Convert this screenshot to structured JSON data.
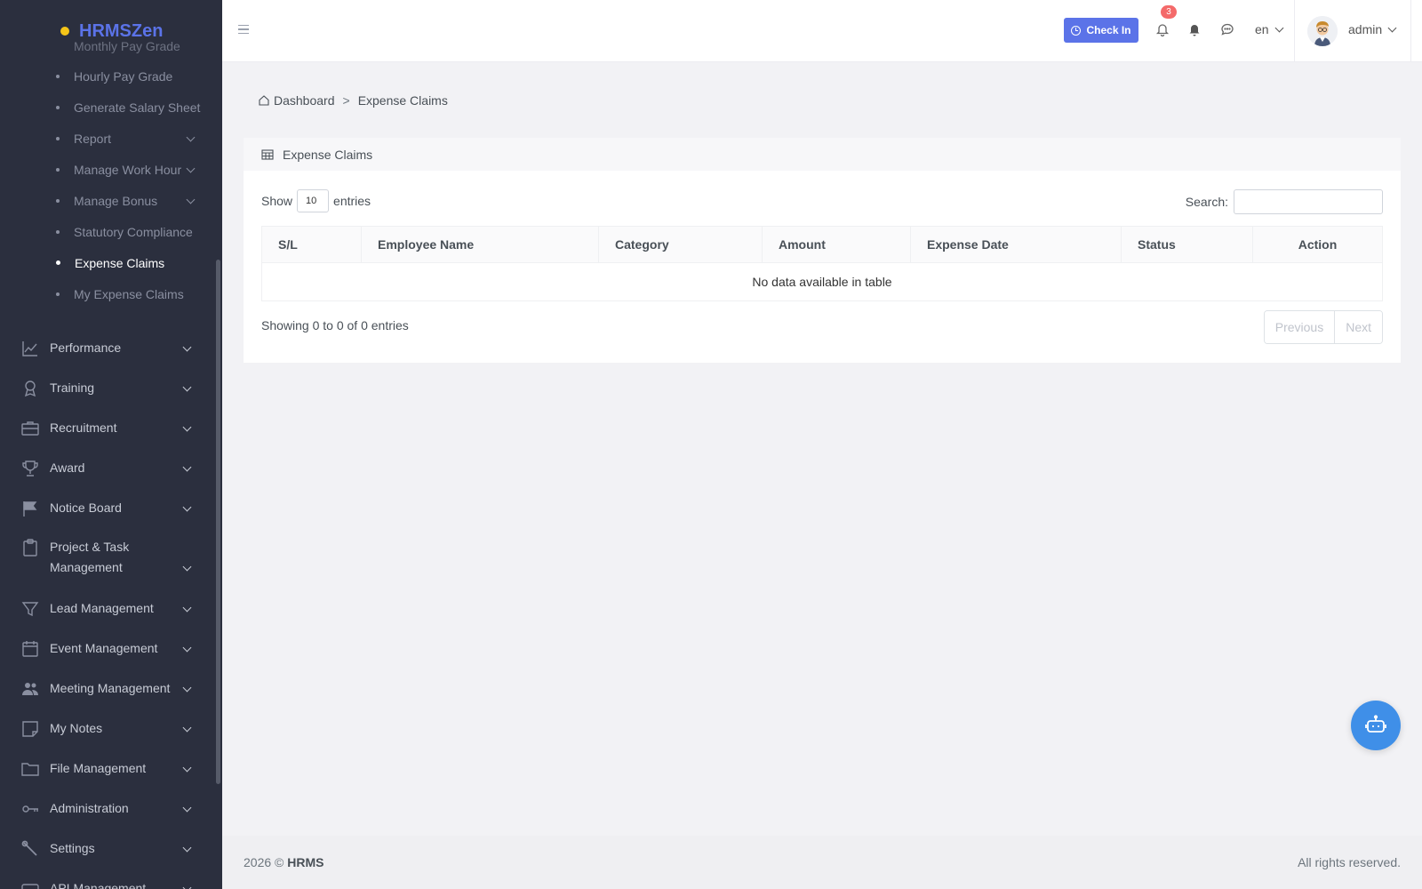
{
  "brand": {
    "name": "HRMSZen"
  },
  "sidebar": {
    "subitems": [
      {
        "label": "Monthly Pay Grade",
        "has_children": false,
        "active": false
      },
      {
        "label": "Hourly Pay Grade",
        "has_children": false,
        "active": false
      },
      {
        "label": "Generate Salary Sheet",
        "has_children": false,
        "active": false
      },
      {
        "label": "Report",
        "has_children": true,
        "active": false
      },
      {
        "label": "Manage Work Hour",
        "has_children": true,
        "active": false
      },
      {
        "label": "Manage Bonus",
        "has_children": true,
        "active": false
      },
      {
        "label": "Statutory Compliance",
        "has_children": false,
        "active": false
      },
      {
        "label": "Expense Claims",
        "has_children": false,
        "active": true
      },
      {
        "label": "My Expense Claims",
        "has_children": false,
        "active": false
      }
    ],
    "items": [
      {
        "label": "Performance",
        "icon": "chart-line-icon"
      },
      {
        "label": "Training",
        "icon": "award-ribbon-icon"
      },
      {
        "label": "Recruitment",
        "icon": "briefcase-icon"
      },
      {
        "label": "Award",
        "icon": "trophy-icon"
      },
      {
        "label": "Notice Board",
        "icon": "flag-icon"
      },
      {
        "label": "Project & Task Management",
        "icon": "clipboard-icon"
      },
      {
        "label": "Lead Management",
        "icon": "funnel-icon"
      },
      {
        "label": "Event Management",
        "icon": "calendar-icon"
      },
      {
        "label": "Meeting Management",
        "icon": "users-icon"
      },
      {
        "label": "My Notes",
        "icon": "note-icon"
      },
      {
        "label": "File Management",
        "icon": "folder-icon"
      },
      {
        "label": "Administration",
        "icon": "key-icon"
      },
      {
        "label": "Settings",
        "icon": "wrench-icon"
      },
      {
        "label": "API Management",
        "icon": "api-icon"
      }
    ]
  },
  "topbar": {
    "checkin_label": "Check In",
    "notification_count": "3",
    "language": "en",
    "username": "admin"
  },
  "breadcrumb": {
    "home": "Dashboard",
    "separator": ">",
    "current": "Expense Claims"
  },
  "card": {
    "title": "Expense Claims",
    "show_label": "Show",
    "entries_value": "10",
    "entries_label": "entries",
    "search_label": "Search:",
    "search_value": "",
    "columns": [
      "S/L",
      "Employee Name",
      "Category",
      "Amount",
      "Expense Date",
      "Status",
      "Action"
    ],
    "empty_message": "No data available in table",
    "info": "Showing 0 to 0 of 0 entries",
    "prev_label": "Previous",
    "next_label": "Next"
  },
  "footer": {
    "year": "2026 ©",
    "company": "HRMS",
    "rights": "All rights reserved."
  },
  "colors": {
    "sidebar_bg": "#2b2f3e",
    "accent": "#5b73e8",
    "badge": "#f46a6a",
    "fab": "#3f8fe8"
  }
}
